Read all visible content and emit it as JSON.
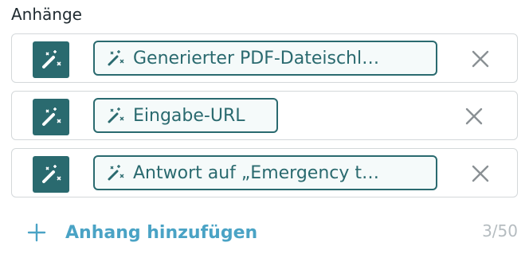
{
  "section": {
    "label": "Anhänge"
  },
  "attachments": [
    {
      "label": "Generierter PDF-Dateischl…",
      "row_icon": "magic-wand-icon",
      "chip_icon": "magic-wand-icon",
      "remove_icon": "close-icon"
    },
    {
      "label": "Eingabe-URL",
      "row_icon": "magic-wand-icon",
      "chip_icon": "magic-wand-icon",
      "remove_icon": "close-icon"
    },
    {
      "label": "Antwort auf „Emergency t…",
      "row_icon": "magic-wand-icon",
      "chip_icon": "magic-wand-icon",
      "remove_icon": "close-icon"
    }
  ],
  "add": {
    "label": "Anhang hinzufügen",
    "icon": "plus-icon"
  },
  "counter": {
    "text": "3/50"
  },
  "colors": {
    "accent": "#2a6a6f",
    "link": "#4aa3c5",
    "border": "#d4d8da",
    "muted": "#b5bcc0"
  }
}
